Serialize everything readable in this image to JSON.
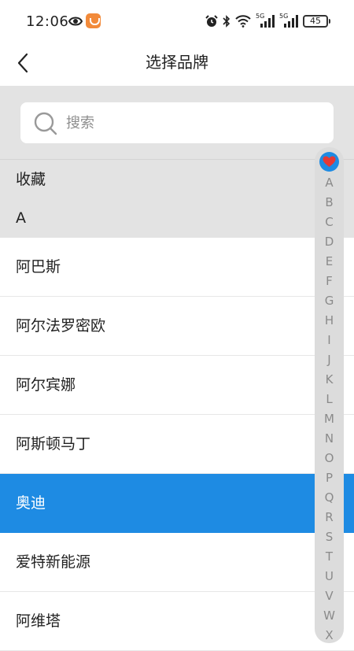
{
  "status_bar": {
    "time": "12:06",
    "battery": "45",
    "network_label": "5G",
    "icons": [
      "eye-icon",
      "app-notification-icon",
      "alarm-icon",
      "bluetooth-icon",
      "wifi-icon",
      "signal-icon",
      "signal-icon",
      "battery-icon"
    ]
  },
  "header": {
    "title": "选择品牌",
    "back_icon": "chevron-left-icon"
  },
  "search": {
    "placeholder": "搜索",
    "value": "",
    "icon": "search-icon"
  },
  "sections": {
    "favorites": "收藏",
    "a": "A"
  },
  "brands": [
    {
      "name": "阿巴斯",
      "selected": false
    },
    {
      "name": "阿尔法罗密欧",
      "selected": false
    },
    {
      "name": "阿尔宾娜",
      "selected": false
    },
    {
      "name": "阿斯顿马丁",
      "selected": false
    },
    {
      "name": "奥迪",
      "selected": true
    },
    {
      "name": "爱特新能源",
      "selected": false
    },
    {
      "name": "阿维塔",
      "selected": false
    }
  ],
  "index_bar": {
    "favorite_icon": "heart-icon",
    "letters": [
      "A",
      "B",
      "C",
      "D",
      "E",
      "F",
      "G",
      "H",
      "I",
      "J",
      "K",
      "L",
      "M",
      "N",
      "O",
      "P",
      "Q",
      "R",
      "S",
      "T",
      "U",
      "V",
      "W",
      "X"
    ]
  },
  "colors": {
    "accent": "#1e8be3",
    "section_background": "#e3e3e3",
    "index_background": "#dcdcdc",
    "heart": "#e53935"
  }
}
